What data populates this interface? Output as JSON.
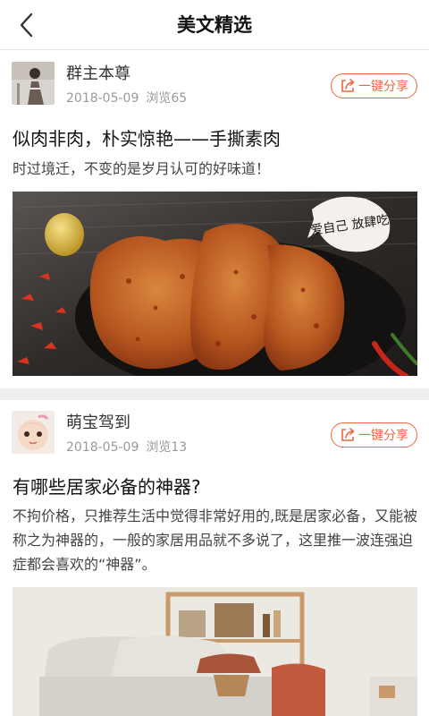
{
  "header": {
    "title": "美文精选"
  },
  "posts": [
    {
      "author": "群主本尊",
      "date": "2018-05-09",
      "views": "浏览65",
      "share_label": "一键分享",
      "title": "似肉非肉，朴实惊艳——手撕素肉",
      "excerpt": "时过境迁，不变的是岁月认可的好味道！",
      "image_caption": "爱自己 放肆吃"
    },
    {
      "author": "萌宝驾到",
      "date": "2018-05-09",
      "views": "浏览13",
      "share_label": "一键分享",
      "title": "有哪些居家必备的神器?",
      "excerpt": "不拘价格，只推荐生活中觉得非常好用的,既是居家必备，又能被称之为神器的，一般的家居用品就不多说了，这里推一波连强迫症都会喜欢的“神器”。"
    }
  ],
  "icons": {
    "back": "chevron-left-icon",
    "share": "share-arrow-icon"
  },
  "colors": {
    "accent": "#f0663f",
    "divider": "#eeeeee"
  }
}
